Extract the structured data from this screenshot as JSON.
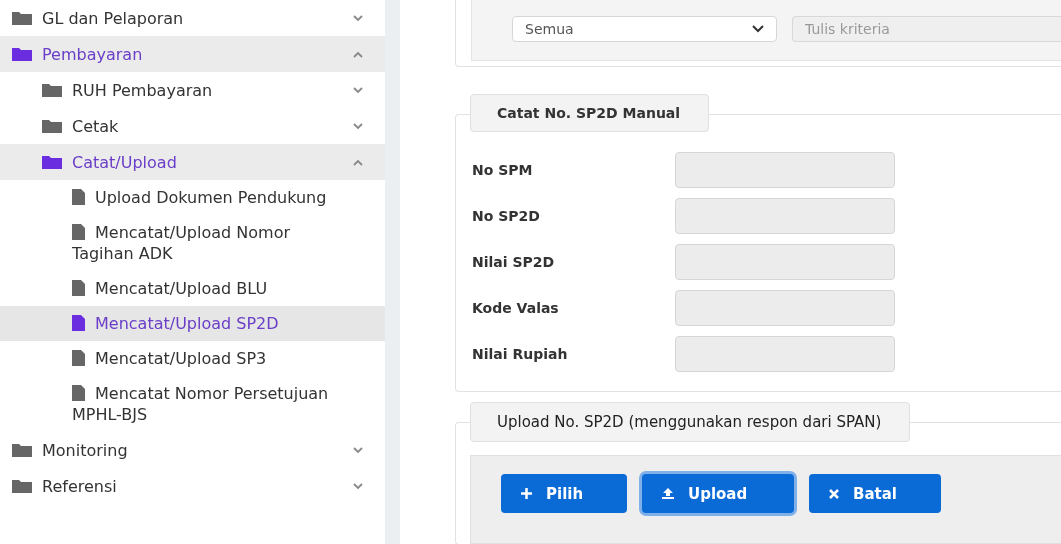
{
  "sidebar": {
    "items": [
      {
        "kind": "folder",
        "label": "GL dan Pelaporan",
        "expanded": false
      },
      {
        "kind": "folder",
        "label": "Pembayaran",
        "expanded": true,
        "children": [
          {
            "kind": "folder",
            "label": "RUH Pembayaran",
            "expanded": false
          },
          {
            "kind": "folder",
            "label": "Cetak",
            "expanded": false
          },
          {
            "kind": "folder",
            "label": "Catat/Upload",
            "expanded": true,
            "children": [
              {
                "kind": "file",
                "label": "Upload Dokumen Pendukung",
                "selected": false
              },
              {
                "kind": "file",
                "label": "Mencatat/Upload Nomor Tagihan ADK",
                "selected": false
              },
              {
                "kind": "file",
                "label": "Mencatat/Upload BLU",
                "selected": false
              },
              {
                "kind": "file",
                "label": "Mencatat/Upload SP2D",
                "selected": true
              },
              {
                "kind": "file",
                "label": "Mencatat/Upload SP3",
                "selected": false
              },
              {
                "kind": "file",
                "label": "Mencatat Nomor Persetujuan MPHL-BJS",
                "selected": false
              }
            ]
          }
        ]
      },
      {
        "kind": "folder",
        "label": "Monitoring",
        "expanded": false
      },
      {
        "kind": "folder",
        "label": "Referensi",
        "expanded": false
      }
    ]
  },
  "filter": {
    "select_value": "Semua",
    "criteria_placeholder": "Tulis kriteria"
  },
  "manual_section": {
    "legend": "Catat No. SP2D Manual",
    "fields": [
      {
        "label": "No SPM"
      },
      {
        "label": "No SP2D"
      },
      {
        "label": "Nilai SP2D"
      },
      {
        "label": "Kode Valas"
      },
      {
        "label": "Nilai Rupiah"
      }
    ]
  },
  "upload_section": {
    "legend": "Upload No. SP2D (menggunakan respon dari SPAN)",
    "buttons": [
      {
        "kind": "add",
        "label": "Pilih",
        "focused": false
      },
      {
        "kind": "upload",
        "label": "Upload",
        "focused": true
      },
      {
        "kind": "cancel",
        "label": "Batal",
        "focused": false
      }
    ]
  }
}
